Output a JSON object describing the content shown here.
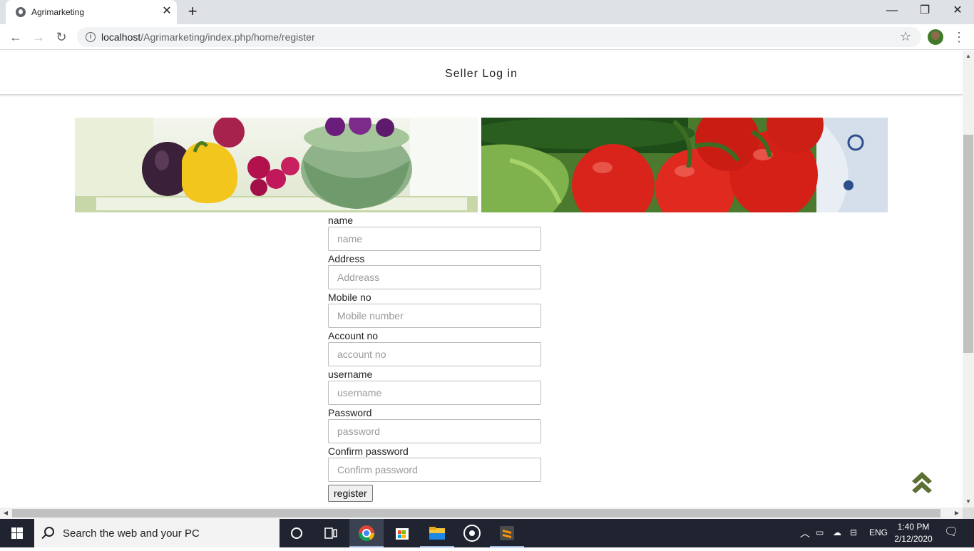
{
  "browser": {
    "tab_title": "Agrimarketing",
    "url_host": "localhost",
    "url_path": "/Agrimarketing/index.php/home/register"
  },
  "page": {
    "header_title": "Seller Log in",
    "form": {
      "fields": [
        {
          "label": "name",
          "placeholder": "name"
        },
        {
          "label": "Address",
          "placeholder": "Addreass"
        },
        {
          "label": "Mobile no",
          "placeholder": "Mobile number"
        },
        {
          "label": "Account no",
          "placeholder": "account no"
        },
        {
          "label": "username",
          "placeholder": "username"
        },
        {
          "label": "Password",
          "placeholder": "password"
        },
        {
          "label": "Confirm password",
          "placeholder": "Confirm password"
        }
      ],
      "submit_label": "register"
    },
    "accent_color": "#5b7032"
  },
  "taskbar": {
    "search_placeholder": "Search the web and your PC",
    "language": "ENG",
    "time": "1:40 PM",
    "date": "2/12/2020"
  }
}
